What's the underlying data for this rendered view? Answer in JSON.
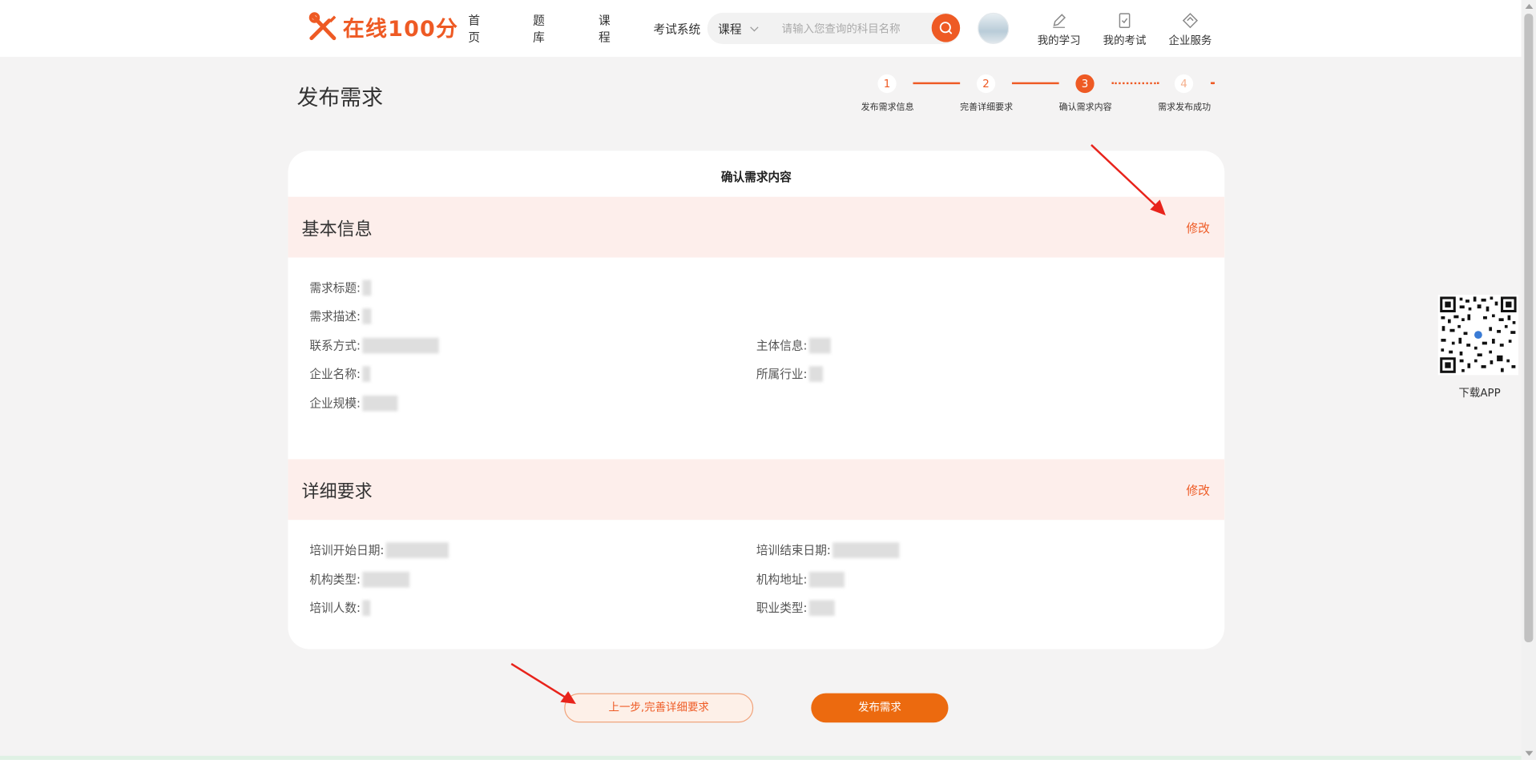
{
  "header": {
    "logo_text": "在线100分",
    "nav": [
      "首页",
      "题库",
      "课程",
      "考试系统"
    ],
    "search": {
      "category": "课程",
      "placeholder": "请输入您查询的科目名称"
    },
    "tools": [
      "我的学习",
      "我的考试",
      "企业服务"
    ]
  },
  "page": {
    "title": "发布需求"
  },
  "steps": [
    {
      "num": "1",
      "label": "发布需求信息",
      "state": "done"
    },
    {
      "num": "2",
      "label": "完善详细要求",
      "state": "done"
    },
    {
      "num": "3",
      "label": "确认需求内容",
      "state": "active"
    },
    {
      "num": "4",
      "label": "需求发布成功",
      "state": "pending"
    }
  ],
  "card": {
    "title": "确认需求内容",
    "basic": {
      "name": "基本信息",
      "edit": "修改",
      "fields": {
        "title": "需求标题:",
        "desc": "需求描述:",
        "contact": "联系方式:",
        "subject": "主体信息:",
        "company": "企业名称:",
        "industry": "所属行业:",
        "scale": "企业规模:"
      }
    },
    "detail": {
      "name": "详细要求",
      "edit": "修改",
      "fields": {
        "start": "培训开始日期:",
        "end": "培训结束日期:",
        "org_type": "机构类型:",
        "org_addr": "机构地址:",
        "people": "培训人数:",
        "job_type": "职业类型:"
      }
    }
  },
  "buttons": {
    "prev": "上一步,完善详细要求",
    "publish": "发布需求"
  },
  "qr": {
    "label": "下载APP"
  },
  "colors": {
    "accent": "#ee5a24",
    "section_bg": "#fdeeeb",
    "button": "#ec6a0f"
  }
}
